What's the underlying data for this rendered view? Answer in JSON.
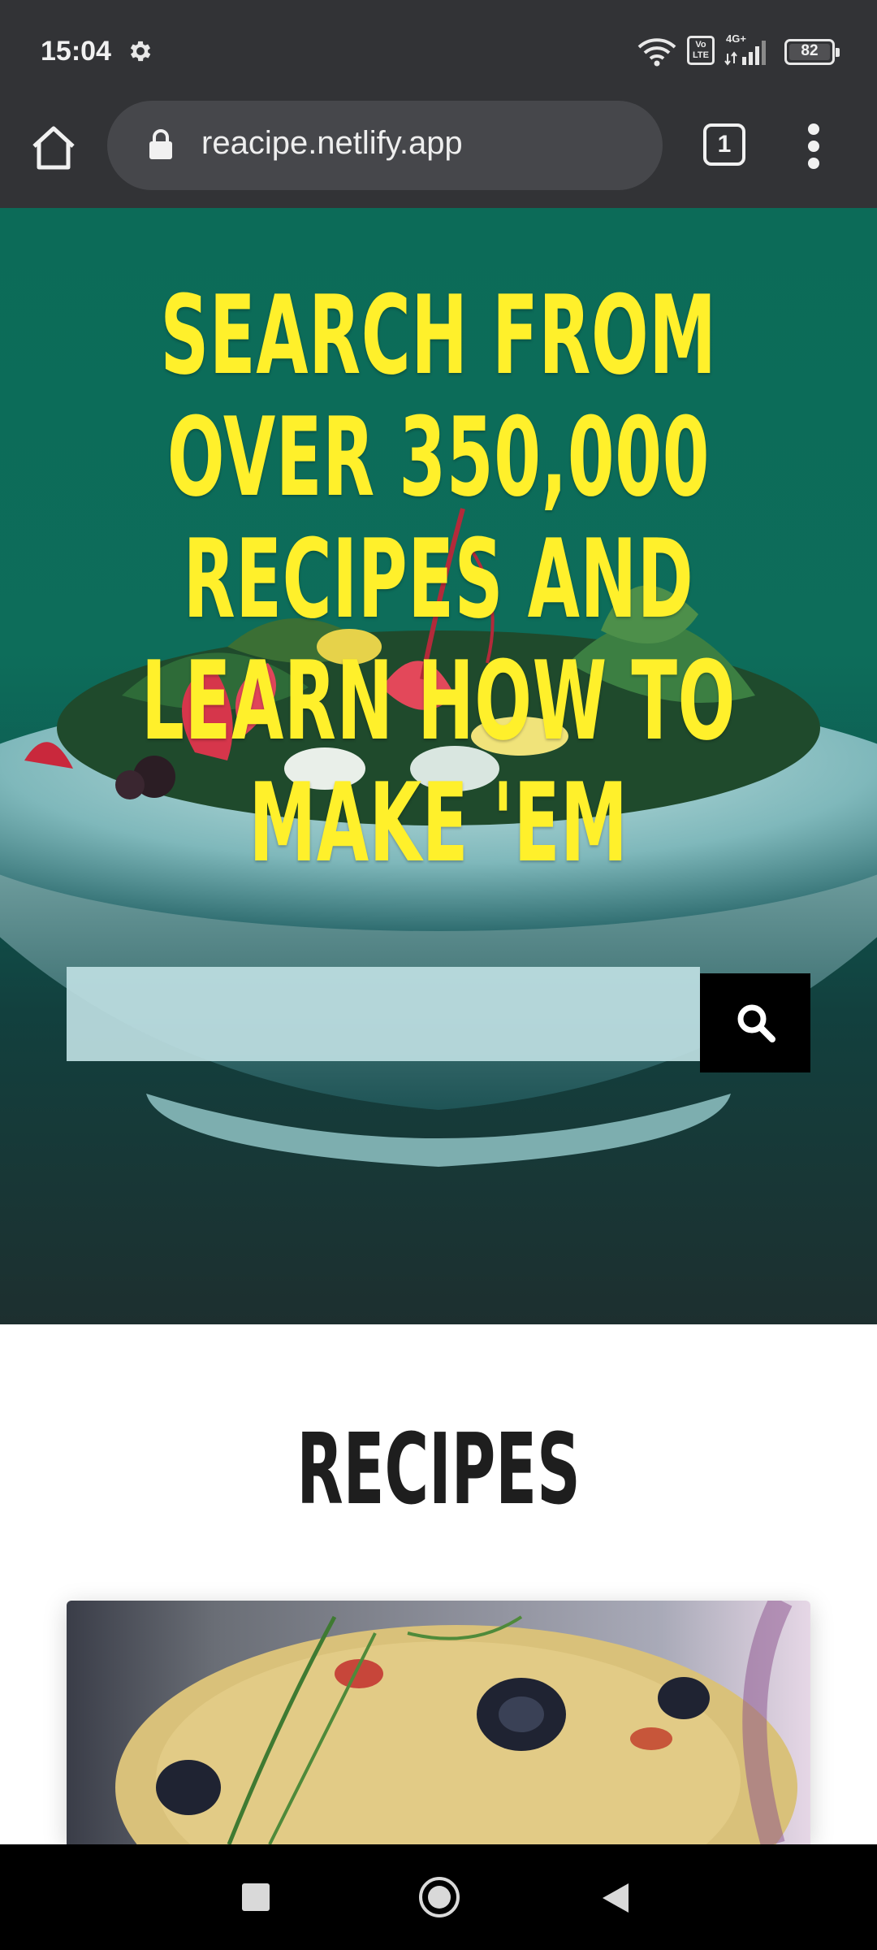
{
  "status_bar": {
    "time": "15:04",
    "signal_label": "4G+",
    "volte_label": "Vo LTE",
    "battery": "82",
    "icons": [
      "gear-icon",
      "wifi-icon",
      "volte-icon",
      "signal-icon",
      "battery-icon"
    ]
  },
  "browser": {
    "url": "reacipe.netlify.app",
    "tab_count": "1",
    "icons": [
      "home-icon",
      "lock-icon",
      "tabs-icon",
      "more-vert-icon"
    ]
  },
  "hero": {
    "title": "SEARCH FROM OVER 350,000 RECIPES AND LEARN HOW TO MAKE 'EM",
    "title_color": "#fff02b",
    "search_value": "",
    "search_placeholder": "",
    "search_icon": "search-icon"
  },
  "recipes": {
    "heading": "RECIPES"
  },
  "nav_bar": {
    "icons": [
      "recents-icon",
      "home-circle-icon",
      "back-icon"
    ]
  }
}
